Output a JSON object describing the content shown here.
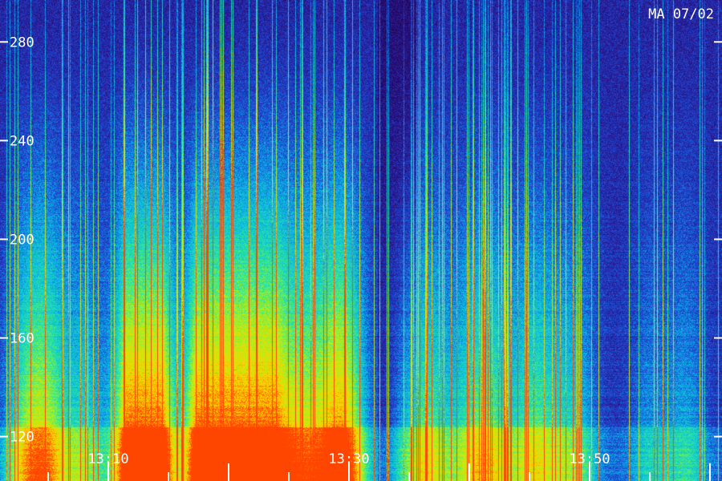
{
  "chart_data": {
    "type": "heatmap",
    "title": "MA 07/02",
    "xlabel": "",
    "ylabel": "",
    "y_ticks": [
      "280",
      "240",
      "200",
      "160",
      "120"
    ],
    "y_tick_values": [
      280,
      240,
      200,
      160,
      120
    ],
    "ylim": [
      102,
      297
    ],
    "x_ticks": [
      "13:10",
      "13:30",
      "13:50"
    ],
    "x_tick_minutes": [
      10,
      30,
      50
    ],
    "xlim_minutes": [
      1,
      61
    ],
    "grid": false,
    "colormap": [
      "#1a0033",
      "#2a1080",
      "#1e46d2",
      "#0ab4e6",
      "#28e6a0",
      "#b4f014",
      "#ffd200",
      "#ff4600"
    ],
    "activity_bursts": [
      {
        "minute": 3,
        "intensity": 0.55
      },
      {
        "minute": 5,
        "intensity": 0.65
      },
      {
        "minute": 8,
        "intensity": 0.45
      },
      {
        "minute": 12,
        "intensity": 0.8
      },
      {
        "minute": 13,
        "intensity": 0.85
      },
      {
        "minute": 14,
        "intensity": 0.75
      },
      {
        "minute": 18,
        "intensity": 0.9
      },
      {
        "minute": 19,
        "intensity": 0.95
      },
      {
        "minute": 20,
        "intensity": 0.9
      },
      {
        "minute": 22,
        "intensity": 0.95
      },
      {
        "minute": 23,
        "intensity": 0.7
      },
      {
        "minute": 25,
        "intensity": 0.6
      },
      {
        "minute": 27,
        "intensity": 0.55
      },
      {
        "minute": 29,
        "intensity": 0.6
      },
      {
        "minute": 30,
        "intensity": 0.5
      },
      {
        "minute": 35,
        "intensity": 0.4
      },
      {
        "minute": 37,
        "intensity": 0.45
      },
      {
        "minute": 40,
        "intensity": 0.45
      },
      {
        "minute": 42,
        "intensity": 0.5
      },
      {
        "minute": 45,
        "intensity": 0.5
      },
      {
        "minute": 47,
        "intensity": 0.3
      },
      {
        "minute": 49,
        "intensity": 0.35
      },
      {
        "minute": 55,
        "intensity": 0.25
      },
      {
        "minute": 58,
        "intensity": 0.3
      }
    ]
  }
}
